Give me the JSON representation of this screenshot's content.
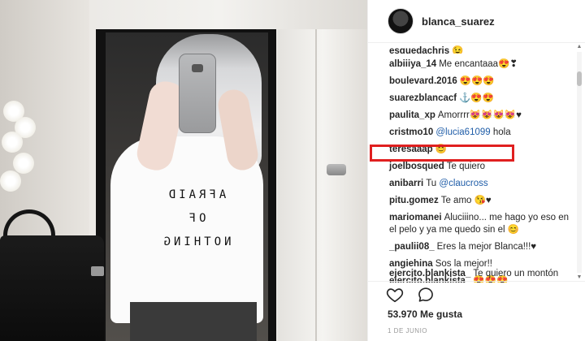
{
  "photo": {
    "shirt_lines": [
      "AFRAID",
      "OF",
      "NOTHING"
    ]
  },
  "header": {
    "username": "blanca_suarez"
  },
  "comments": [
    {
      "user": "esquedachris",
      "text": "😉"
    },
    {
      "user": "albiiiya_14",
      "text": "Me encantaaa😍❣"
    },
    {
      "user": "boulevard.2016",
      "text": "😍😍😍"
    },
    {
      "user": "suarezblancacf",
      "text": "⚓😍😍"
    },
    {
      "user": "paulita_xp",
      "text": "Amorrrr😻😻😻😻♥"
    },
    {
      "user": "cristmo10",
      "mention": "@lucia61099",
      "text": "hola"
    },
    {
      "user": "teresaaap",
      "text": "😊"
    },
    {
      "user": "joelbosqued",
      "text": "Te quiero"
    },
    {
      "user": "anibarri",
      "text": "Tu",
      "mention": "@claucross"
    },
    {
      "user": "pitu.gomez",
      "text": "Te amo 😘♥"
    },
    {
      "user": "mariomanei",
      "text": "Aluciiino... me hago yo eso en el pelo y ya me quedo sin el 😊"
    },
    {
      "user": "_paulii08_",
      "text": "Eres la mejor Blanca!!!♥"
    },
    {
      "user": "angiehina",
      "text": "Sos la mejor!!"
    },
    {
      "user": "ejercito.blankista_",
      "text": "😍😍😍"
    },
    {
      "user": "ejercito.blankista_",
      "text": "Te quiero un montón"
    }
  ],
  "highlight": {
    "color": "#e02020",
    "target_user": "joelbosqued"
  },
  "actions": {
    "like_icon": "heart-icon",
    "comment_icon": "comment-bubble-icon"
  },
  "likes_text": "53.970 Me gusta",
  "date_text": "1 DE JUNIO",
  "colors": {
    "mention": "#1f5da8",
    "text": "#262626",
    "muted": "#999999"
  }
}
